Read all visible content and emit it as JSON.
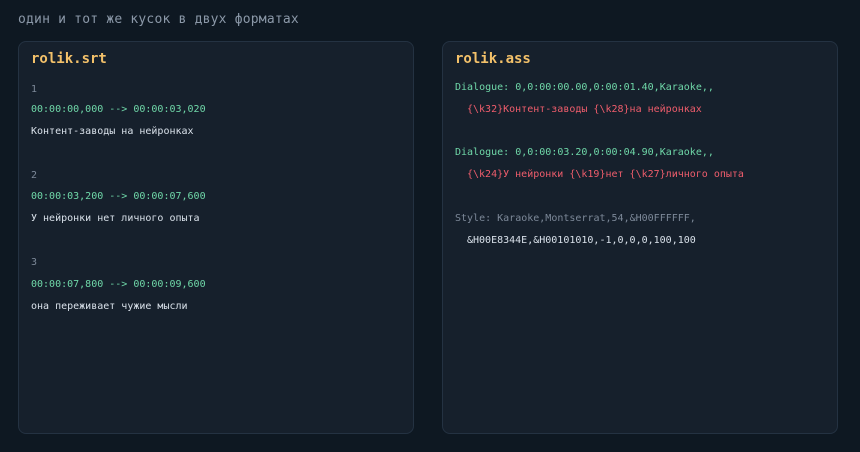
{
  "page": {
    "title": "один и тот же кусок в двух форматах"
  },
  "srt_panel": {
    "title": "rolik.srt",
    "cues": [
      {
        "index": "1",
        "time": "00:00:00,000 --> 00:00:03,020",
        "text": "Контент-заводы на нейронках"
      },
      {
        "index": "2",
        "time": "00:00:03,200 --> 00:00:07,600",
        "text": "У нейронки нет личного опыта"
      },
      {
        "index": "3",
        "time": "00:00:07,800 --> 00:00:09,600",
        "text": "она переживает чужие мысли"
      }
    ]
  },
  "ass_panel": {
    "title": "rolik.ass",
    "dialogues": [
      {
        "header": "Dialogue: 0,0:00:00.00,0:00:01.40,Karaoke,,",
        "text": "{\\k32}Контент-заводы {\\k28}на нейронках"
      },
      {
        "header": "Dialogue: 0,0:00:03.20,0:00:04.90,Karaoke,,",
        "text": "{\\k24}У нейронки {\\k19}нет {\\k27}личного опыта"
      }
    ],
    "style": {
      "line1": "Style: Karaoke,Montserrat,54,&H00FFFFFF,",
      "line2": "&H00E8344E,&H00101010,-1,0,0,0,100,100"
    }
  },
  "colors": {
    "background": "#0e1822",
    "panel": "#16202c",
    "title": "#f3c16a",
    "timecode": "#6fd7a8",
    "karaoke": "#ef5d6c",
    "muted": "#7c8898",
    "text": "#d9e1ea"
  }
}
